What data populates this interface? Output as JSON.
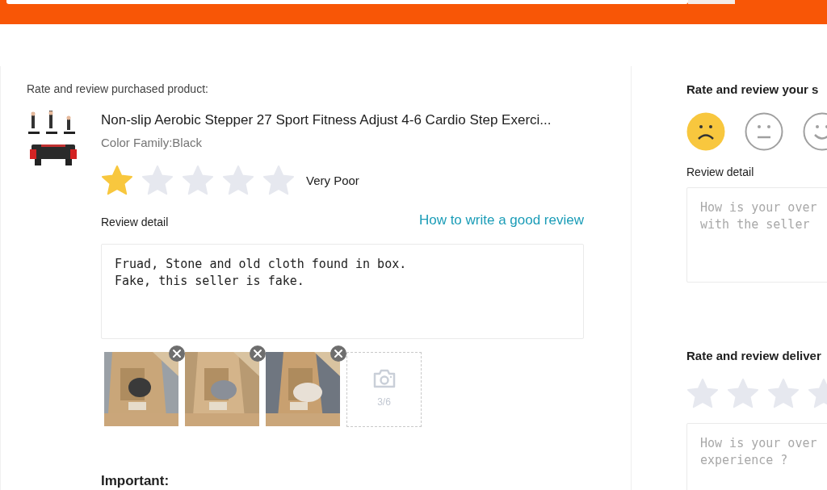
{
  "header": {
    "search": {
      "kind": "field"
    }
  },
  "product": {
    "heading": "Rate and review purchased product:",
    "title": "Non-slip Aerobic Stepper 27 Sport Fitness Adjust 4-6 Cardio Step Exerci...",
    "variant": "Color Family:Black",
    "stars": 1,
    "rating_label": "Very Poor",
    "review_label": "Review detail",
    "help_link": "How to write a good review",
    "review_text": "Fruad, Stone and old cloth found in box.\nFake, this seller is fake.",
    "photos": [
      {
        "kind": "picture"
      },
      {
        "kind": "picture"
      },
      {
        "kind": "picture"
      }
    ],
    "upload_count": "3/6",
    "important": "Important:"
  },
  "seller": {
    "title": "Rate and review your s",
    "faces": [
      {
        "kind": "sad",
        "selected": true
      },
      {
        "kind": "neutral",
        "selected": false
      },
      {
        "kind": "happy",
        "selected": false
      }
    ],
    "review_label": "Review detail",
    "placeholder": "How is your over\nwith the seller"
  },
  "delivery": {
    "title": "Rate and review deliver",
    "stars": 0,
    "placeholder": "How is your over\nexperience ?"
  }
}
